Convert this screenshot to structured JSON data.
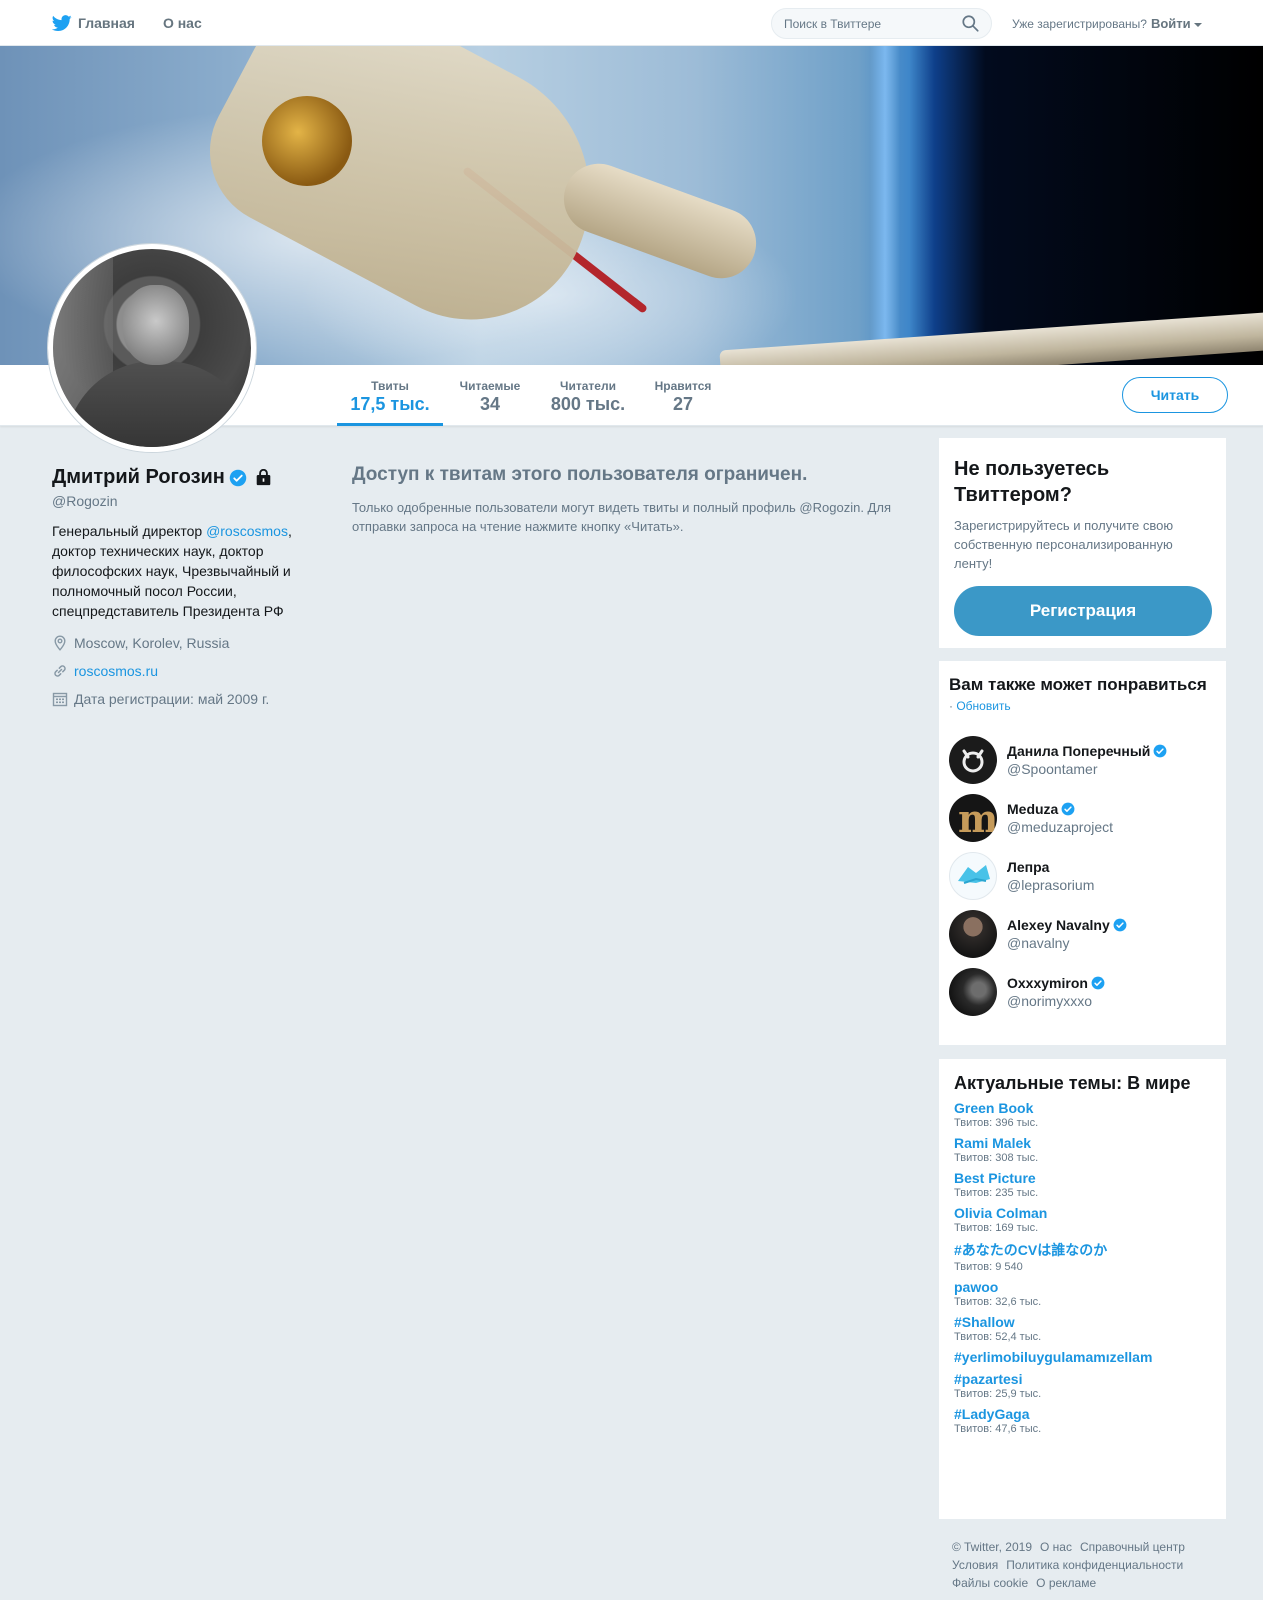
{
  "nav": {
    "home": "Главная",
    "about": "О нас",
    "search_placeholder": "Поиск в Твиттере",
    "already_registered": "Уже зарегистрированы?",
    "login": "Войти"
  },
  "stats": [
    {
      "label": "Твиты",
      "value": "17,5 тыс."
    },
    {
      "label": "Читаемые",
      "value": "34"
    },
    {
      "label": "Читатели",
      "value": "800 тыс."
    },
    {
      "label": "Нравится",
      "value": "27"
    }
  ],
  "follow_button": "Читать",
  "profile": {
    "name": "Дмитрий Рогозин",
    "handle": "@Rogozin",
    "bio_prefix": "Генеральный директор ",
    "bio_mention": "@roscosmos",
    "bio_suffix": ", доктор технических наук, доктор философских наук, Чрезвычайный и полномочный посол России, спецпредставитель Президента РФ",
    "location": "Moscow, Korolev, Russia",
    "url": "roscosmos.ru",
    "joined": "Дата регистрации: май 2009 г."
  },
  "protected": {
    "title": "Доступ к твитам этого пользователя ограничен.",
    "text": "Только одобренные пользователи могут видеть твиты и полный профиль @Rogozin. Для отправки запроса на чтение нажмите кнопку «Читать»."
  },
  "signup": {
    "title": "Не пользуетесь Твиттером?",
    "text": "Зарегистрируйтесь и получите свою собственную персонализированную ленту!",
    "button": "Регистрация"
  },
  "wtf": {
    "title": "Вам также может понравиться",
    "refresh_dot": "·",
    "refresh": "Обновить",
    "users": [
      {
        "name": "Данила Поперечный",
        "handle": "@Spoontamer",
        "verified": true
      },
      {
        "name": "Meduza",
        "handle": "@meduzaproject",
        "verified": true
      },
      {
        "name": "Лепра",
        "handle": "@leprasorium",
        "verified": false
      },
      {
        "name": "Alexey Navalny",
        "handle": "@navalny",
        "verified": true
      },
      {
        "name": "Oxxxymiron",
        "handle": "@norimyxxxo",
        "verified": true
      }
    ]
  },
  "trends": {
    "title": "Актуальные темы: В мире",
    "items": [
      {
        "name": "Green Book",
        "count": "Твитов: 396 тыс."
      },
      {
        "name": "Rami Malek",
        "count": "Твитов: 308 тыс."
      },
      {
        "name": "Best Picture",
        "count": "Твитов: 235 тыс."
      },
      {
        "name": "Olivia Colman",
        "count": "Твитов: 169 тыс."
      },
      {
        "name": "#あなたのCVは誰なのか",
        "count": "Твитов: 9 540"
      },
      {
        "name": "pawoo",
        "count": "Твитов: 32,6 тыс."
      },
      {
        "name": "#Shallow",
        "count": "Твитов: 52,4 тыс."
      },
      {
        "name": "#yerlimobiluygulamamızellam",
        "count": ""
      },
      {
        "name": "#pazartesi",
        "count": "Твитов: 25,9 тыс."
      },
      {
        "name": "#LadyGaga",
        "count": "Твитов: 47,6 тыс."
      }
    ]
  },
  "footer": {
    "copyright": "© Twitter, 2019",
    "about": "О нас",
    "help": "Справочный центр",
    "terms": "Условия",
    "privacy": "Политика конфиденциальности",
    "cookies": "Файлы cookie",
    "ads": "О рекламе"
  },
  "colors": {
    "accent": "#1b95e0",
    "signup_button": "#3b98c7",
    "page_bg": "#e6ecf0"
  }
}
